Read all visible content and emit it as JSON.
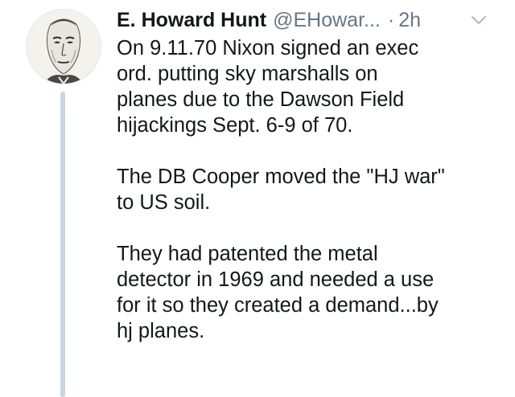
{
  "tweet": {
    "author_name": "E. Howard Hunt",
    "handle": "@EHowar...",
    "separator": "·",
    "time": "2h",
    "avatar_icon": "sketch-portrait-avatar",
    "menu_icon": "chevron-down-icon",
    "paragraphs": [
      [
        "On 9.11.70 Nixon signed an exec",
        "ord. putting sky marshalls on",
        "planes due to the Dawson Field",
        "hijackings Sept. 6-9 of 70."
      ],
      [
        "The DB Cooper moved the \"HJ war\"",
        "to US soil."
      ],
      [
        "They had patented the metal",
        "detector in 1969 and needed a use",
        "for it so they created a demand...by",
        "hj planes."
      ]
    ]
  },
  "colors": {
    "text": "#14171a",
    "secondary_text": "#657786",
    "thread_line": "#c8d6e1",
    "background": "#ffffff"
  }
}
